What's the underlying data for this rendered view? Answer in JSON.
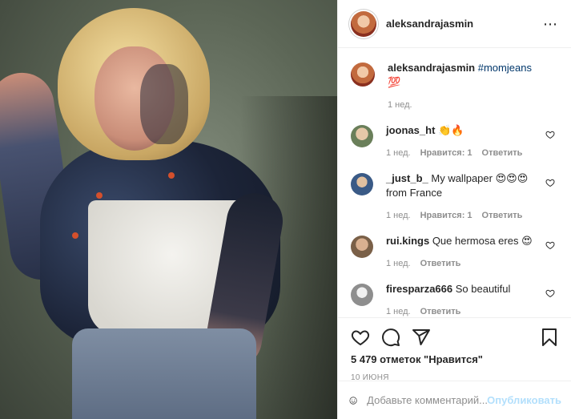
{
  "post": {
    "author": "aleksandrajasmin",
    "more_icon": "⋯",
    "caption": {
      "username": "aleksandrajasmin",
      "hashtag": "#momjeans",
      "emoji": "💯",
      "time": "1 нед."
    },
    "comments": [
      {
        "username": "joonas_ht",
        "text": "",
        "emoji": "👏🔥",
        "time": "1 нед.",
        "likes": "Нравится: 1",
        "reply": "Ответить",
        "avatar_color": "#6a7f5a"
      },
      {
        "username": "_just_b_",
        "text": "My wallpaper",
        "emoji": "😍😍😍",
        "text2": "from France",
        "time": "1 нед.",
        "likes": "Нравится: 1",
        "reply": "Ответить",
        "avatar_color": "#3a5a86"
      },
      {
        "username": "rui.kings",
        "text": "Que hermosa eres",
        "emoji": "😍",
        "time": "1 нед.",
        "reply": "Ответить",
        "avatar_color": "#7a6048"
      },
      {
        "username": "firesparza666",
        "text": "So beautiful",
        "emoji": "",
        "time": "1 нед.",
        "reply": "Ответить",
        "avatar_color": "#8e8e8e"
      }
    ],
    "likes_text": "5 479 отметок \"Нравится\"",
    "date": "10 ИЮНЯ",
    "comment_placeholder": "Добавьте комментарий...",
    "publish_label": "Опубликовать",
    "icons": {
      "like": "heart-icon",
      "comment": "comment-icon",
      "share": "share-icon",
      "save": "bookmark-icon",
      "emoji": "smiley-icon"
    },
    "colors": {
      "hashtag": "#00376b",
      "publish_disabled": "#b2dffc",
      "muted": "#8e8e8e"
    }
  }
}
